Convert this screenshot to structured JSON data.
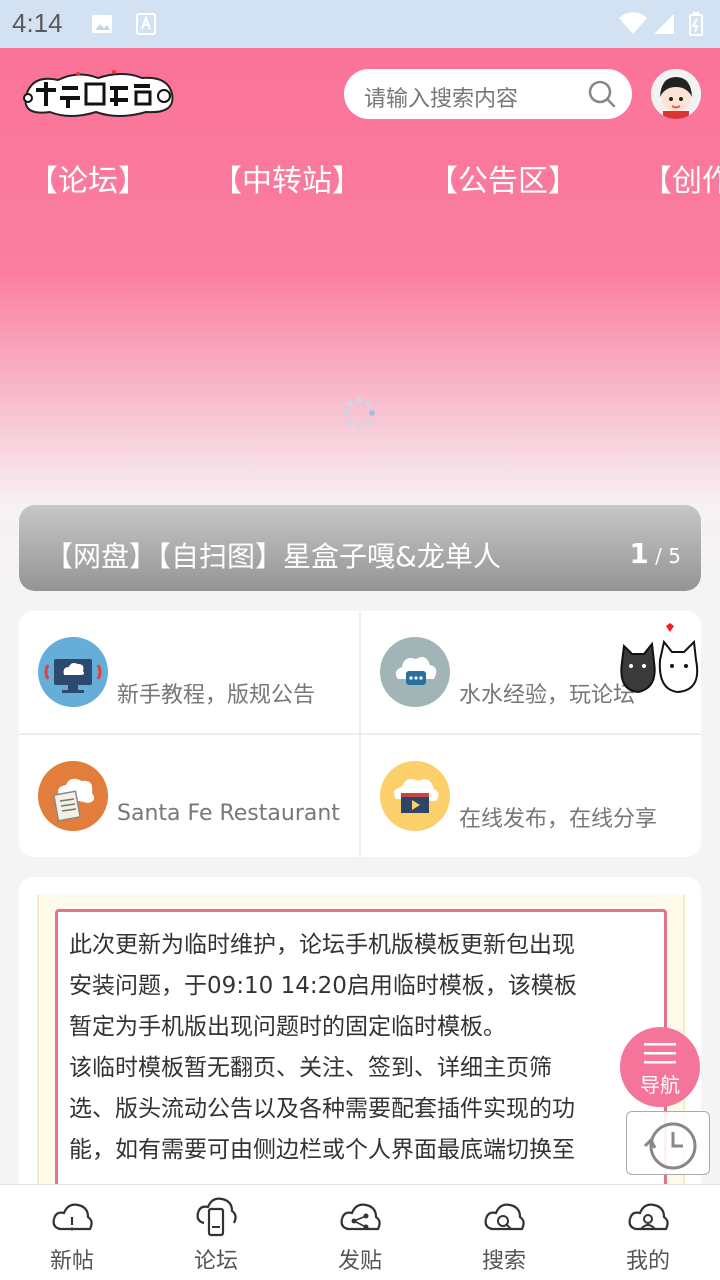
{
  "status_bar": {
    "time": "4:14"
  },
  "header": {
    "search_placeholder": "请输入搜索内容"
  },
  "top_nav": [
    "【论坛】",
    "【中转站】",
    "【公告区】",
    "【创作"
  ],
  "banner": {
    "title": "【网盘】【自扫图】星盒子嘎&龙单人",
    "current": "1",
    "total": "/ 5"
  },
  "categories": [
    {
      "desc": "新手教程，版规公告",
      "icon": "monitor-cloud-icon",
      "color": "#64aed8"
    },
    {
      "desc": "水水经验，玩论坛",
      "icon": "chat-cloud-icon",
      "color": "#a1b4b6"
    },
    {
      "desc": "Santa Fe Restaurant",
      "icon": "document-cloud-icon",
      "color": "#e27d3c"
    },
    {
      "desc": "在线发布，在线分享",
      "icon": "video-cloud-icon",
      "color": "#fbd06a"
    }
  ],
  "notice": {
    "lines": [
      "此次更新为临时维护，论坛手机版模板更新包出现",
      "安装问题，于09:10  14:20启用临时模板，该模板",
      "暂定为手机版出现问题时的固定临时模板。",
      "该临时模板暂无翻页、关注、签到、详细主页筛",
      "选、版头流动公告以及各种需要配套插件实现的功",
      "能，如有需要可由侧边栏或个人界面最底端切换至"
    ]
  },
  "fab": {
    "label": "导航"
  },
  "tabbar": [
    {
      "label": "新帖",
      "icon": "cloud-alert-icon"
    },
    {
      "label": "论坛",
      "icon": "cloud-phone-icon"
    },
    {
      "label": "发贴",
      "icon": "cloud-share-icon"
    },
    {
      "label": "搜索",
      "icon": "cloud-search-icon"
    },
    {
      "label": "我的",
      "icon": "cloud-user-icon"
    }
  ],
  "colors": {
    "brand_pink": "#fa7398",
    "fab_pink": "#f4749a"
  }
}
